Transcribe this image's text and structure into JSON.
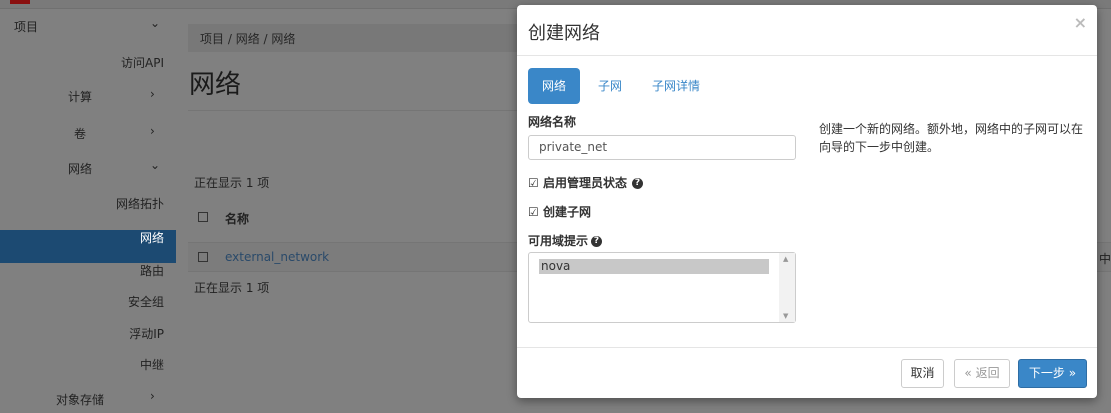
{
  "sidebar": {
    "items": [
      {
        "label": "项目",
        "chevron": "chevron-down"
      },
      {
        "label": "访问API"
      },
      {
        "label": "计算",
        "chevron": "chevron-right"
      },
      {
        "label": "卷",
        "chevron": "chevron-right"
      },
      {
        "label": "网络",
        "chevron": "chevron-down"
      },
      {
        "label": "网络拓扑"
      },
      {
        "label": "网络",
        "active": true
      },
      {
        "label": "路由"
      },
      {
        "label": "安全组"
      },
      {
        "label": "浮动IP"
      },
      {
        "label": "中继"
      },
      {
        "label": "对象存储",
        "chevron": "chevron-right"
      }
    ]
  },
  "breadcrumb": [
    "项目",
    "网络",
    "网络"
  ],
  "page_title": "网络",
  "table": {
    "count_top": "正在显示 1 项",
    "count_bottom": "正在显示 1 项",
    "header": "名称",
    "rows": [
      {
        "name": "external_network"
      }
    ],
    "edge_char": "中"
  },
  "modal": {
    "title": "创建网络",
    "close": "×",
    "tabs": [
      {
        "label": "网络",
        "active": true
      },
      {
        "label": "子网"
      },
      {
        "label": "子网详情"
      }
    ],
    "name_label": "网络名称",
    "name_value": "private_net",
    "admin_state_label": "启用管理员状态",
    "admin_state_checked": true,
    "create_subnet_label": "创建子网",
    "create_subnet_checked": true,
    "az_label": "可用域提示",
    "az_options": [
      "nova"
    ],
    "help_text": "创建一个新的网络。额外地，网络中的子网可以在向导的下一步中创建。",
    "cancel": "取消",
    "back": "« 返回",
    "next": "下一步 »"
  },
  "colors": {
    "accent": "#3a87c8",
    "sidebar_active": "#1c4a72"
  }
}
